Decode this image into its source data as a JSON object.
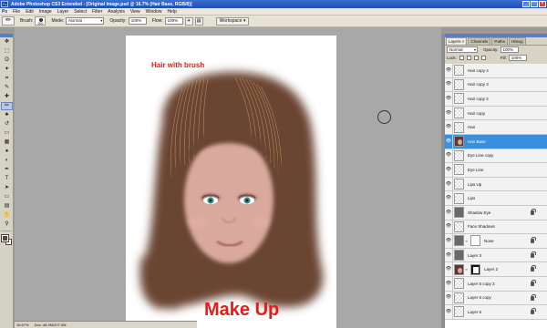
{
  "titlebar": {
    "app_icon": "Ps",
    "title": "Adobe Photoshop CS3 Extended - [Original Image.psd @ 16.7% (Hair Base, RGB/8)]",
    "buttons": [
      "_",
      "□",
      "×"
    ]
  },
  "menubar": {
    "items": [
      "Ps",
      "File",
      "Edit",
      "Image",
      "Layer",
      "Select",
      "Filter",
      "Analysis",
      "View",
      "Window",
      "Help"
    ]
  },
  "options": {
    "brush_label": "Brush:",
    "brush_size": "200",
    "mode_label": "Mode:",
    "mode_value": "Normal",
    "opacity_label": "Opacity:",
    "opacity_value": "100%",
    "flow_label": "Flow:",
    "flow_value": "100%",
    "workspace_label": "Workspace ▾"
  },
  "toolbox": {
    "tools": [
      "move-icon",
      "marquee-icon",
      "lasso-icon",
      "magic-wand-icon",
      "crop-icon",
      "eyedropper-icon",
      "healing-icon",
      "brush-icon",
      "stamp-icon",
      "history-brush-icon",
      "eraser-icon",
      "gradient-icon",
      "blur-icon",
      "dodge-icon",
      "pen-icon",
      "type-icon",
      "path-select-icon",
      "shape-icon",
      "notes-icon",
      "hand-icon",
      "zoom-icon"
    ],
    "glyphs": [
      "✥",
      "⬚",
      "ʘ",
      "✦",
      "⌗",
      "✎",
      "✚",
      "✏",
      "♣",
      "↺",
      "▭",
      "▦",
      "●",
      "◐",
      "✒",
      "T",
      "➤",
      "▭",
      "▤",
      "✋",
      "⚲"
    ],
    "active_index": 7,
    "foreground_color": "#6b3d2e",
    "background_color": "#ffffff"
  },
  "canvas": {
    "caption_top": "Hair with brush",
    "caption_bottom": "Make Up",
    "caption_color": "#e51b1b",
    "hair_color": "#6b4433",
    "skin_color": "#d9a99e"
  },
  "status": {
    "zoom": "16.67%",
    "doc": "Doc: 48.9M/207.4M"
  },
  "layers_panel": {
    "tabs": [
      "Layers ×",
      "Channels",
      "Paths",
      "Histog"
    ],
    "blend_mode": "Normal",
    "opacity_label": "Opacity:",
    "opacity_value": "100%",
    "lock_label": "Lock:",
    "fill_label": "Fill:",
    "fill_value": "100%",
    "layers": [
      {
        "name": "Hair copy 4",
        "thumb": "transparent",
        "locked": false,
        "selected": false
      },
      {
        "name": "Hair copy 3",
        "thumb": "transparent",
        "locked": false,
        "selected": false
      },
      {
        "name": "Hair copy 2",
        "thumb": "transparent",
        "locked": false,
        "selected": false
      },
      {
        "name": "Hair copy",
        "thumb": "transparent",
        "locked": false,
        "selected": false
      },
      {
        "name": "Hair",
        "thumb": "transparent",
        "locked": false,
        "selected": false
      },
      {
        "name": "Hair Base",
        "thumb": "face",
        "locked": false,
        "selected": true
      },
      {
        "name": "Eye Line copy",
        "thumb": "transparent",
        "locked": false,
        "selected": false
      },
      {
        "name": "Eye Line",
        "thumb": "transparent",
        "locked": false,
        "selected": false
      },
      {
        "name": "Lips Up",
        "thumb": "transparent",
        "locked": false,
        "selected": false
      },
      {
        "name": "Lips",
        "thumb": "transparent",
        "locked": false,
        "selected": false
      },
      {
        "name": "Shadow Eye",
        "thumb": "dark",
        "locked": true,
        "selected": false
      },
      {
        "name": "Face Shadows",
        "thumb": "transparent",
        "locked": false,
        "selected": false
      },
      {
        "name": "Nose",
        "thumb": "dark",
        "mask": "white",
        "locked": true,
        "selected": false
      },
      {
        "name": "Layer 3",
        "thumb": "dark",
        "locked": true,
        "selected": false
      },
      {
        "name": "Layer 2",
        "thumb": "face",
        "mask": "black",
        "locked": true,
        "selected": false
      },
      {
        "name": "Layer 5 copy 3",
        "thumb": "transparent",
        "locked": true,
        "selected": false
      },
      {
        "name": "Layer 5 copy",
        "thumb": "transparent",
        "locked": true,
        "selected": false
      },
      {
        "name": "Layer 5",
        "thumb": "transparent",
        "locked": true,
        "selected": false
      }
    ]
  }
}
